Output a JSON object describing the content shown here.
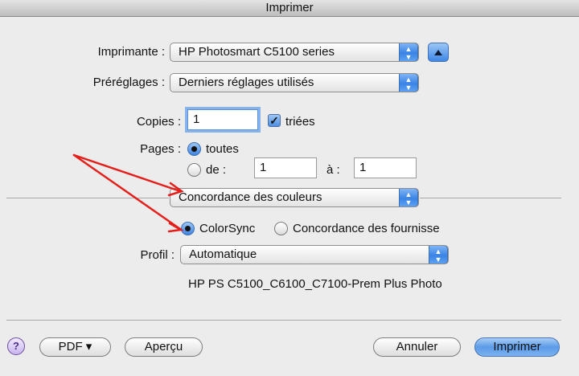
{
  "window": {
    "title": "Imprimer"
  },
  "printer": {
    "label": "Imprimante :",
    "value": "HP Photosmart C5100 series"
  },
  "presets": {
    "label": "Préréglages :",
    "value": "Derniers réglages utilisés"
  },
  "copies": {
    "label": "Copies :",
    "value": "1",
    "collate_label": "triées",
    "collate_checked": true
  },
  "pages": {
    "label": "Pages :",
    "all_label": "toutes",
    "from_label": "de :",
    "from_value": "1",
    "to_label": "à :",
    "to_value": "1"
  },
  "panel_menu": {
    "value": "Concordance des couleurs"
  },
  "color_matching": {
    "option_colorsync": "ColorSync",
    "option_vendor": "Concordance des fournisse",
    "selected": "ColorSync"
  },
  "profile": {
    "label": "Profil :",
    "value": "Automatique",
    "description": "HP PS C5100_C6100_C7100-Prem Plus Photo"
  },
  "buttons": {
    "help": "?",
    "pdf": "PDF ▾",
    "preview": "Aperçu",
    "cancel": "Annuler",
    "print": "Imprimer"
  },
  "colors": {
    "annotation_arrow": "#e3201b",
    "accent": "#3a84e6"
  }
}
